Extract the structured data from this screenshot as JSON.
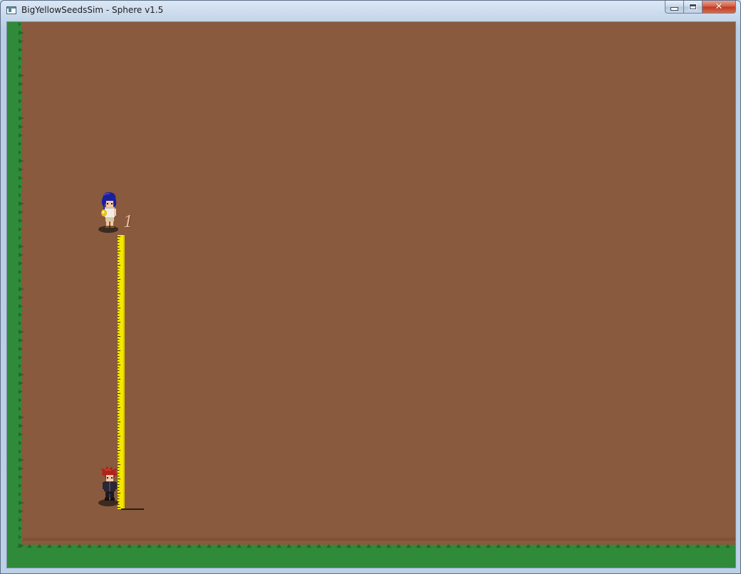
{
  "window": {
    "title": "BigYellowSeedsSim - Sphere v1.5",
    "icon": "app-window-icon",
    "controls": {
      "minimize": "minimize-icon",
      "maximize": "maximize-icon",
      "close": "close-icon"
    }
  },
  "game": {
    "terrain": {
      "ground": "dirt",
      "border": "grass",
      "colors": {
        "dirt": "#895a3d",
        "grass": "#2f8a3a",
        "grass_dark": "#1f6b2a"
      }
    },
    "measure": {
      "label": "1",
      "ruler_color": "#f7e600"
    },
    "characters": [
      {
        "name": "blue-haired-girl",
        "hair_color": "#1b1f9e",
        "holding": "yellow-seed"
      },
      {
        "name": "red-haired-boy",
        "hair_color": "#b0231a"
      }
    ]
  }
}
